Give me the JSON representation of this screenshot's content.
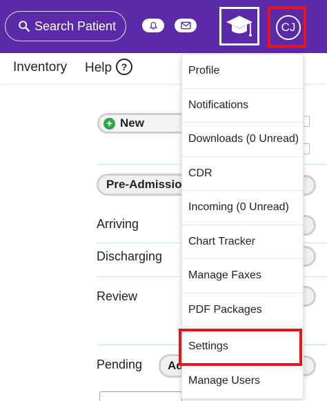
{
  "header": {
    "search_label": "Search Patient",
    "bell_icon": "bell-icon",
    "mail_icon": "mail-icon",
    "education_icon": "graduation-cap-icon",
    "avatar_initials": "CJ",
    "brand_color": "#5b2aa8",
    "highlight_color": "#e8141a"
  },
  "nav": {
    "inventory_label": "Inventory",
    "help_label": "Help",
    "help_icon": "question-icon"
  },
  "main": {
    "new_button_label": "New",
    "pre_admission_label": "Pre-Admission",
    "arriving_label": "Arriving",
    "discharging_label": "Discharging",
    "review_label": "Review",
    "pending_label": "Pending",
    "pending_button_label": "Ad"
  },
  "menu": {
    "items": [
      {
        "label": "Profile"
      },
      {
        "label": "Notifications"
      },
      {
        "label": "Downloads (0 Unread)"
      },
      {
        "label": "CDR"
      },
      {
        "label": "Incoming (0 Unread)"
      },
      {
        "label": "Chart Tracker"
      },
      {
        "label": "Manage Faxes"
      },
      {
        "label": "PDF Packages"
      },
      {
        "label": "Settings"
      },
      {
        "label": "Manage Users"
      }
    ],
    "highlighted_item": "Settings"
  }
}
